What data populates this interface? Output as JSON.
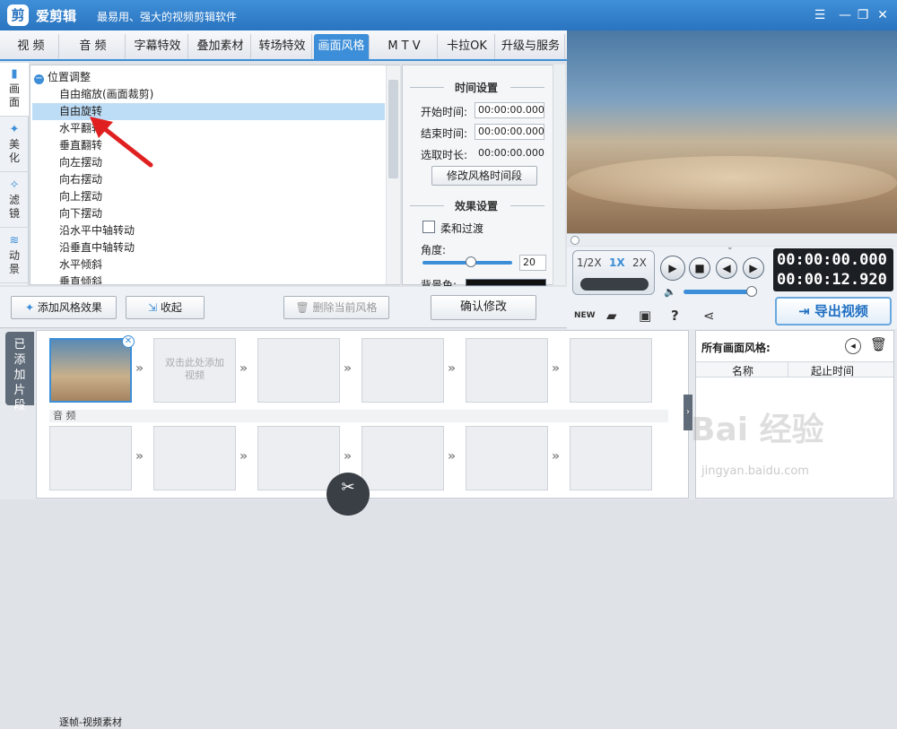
{
  "app": {
    "name": "爱剪辑",
    "logo": "剪",
    "slogan": "最易用、强大的视频剪辑软件"
  },
  "window": {
    "menu": "☰",
    "minimize": "—",
    "maximize": "❐",
    "close": "✕"
  },
  "tabs": [
    "视 频",
    "音 频",
    "字幕特效",
    "叠加素材",
    "转场特效",
    "画面风格",
    "M T V",
    "卡拉OK",
    "升级与服务"
  ],
  "active_tab": "画面风格",
  "side_tabs": [
    "画面",
    "美化",
    "滤镜",
    "动景"
  ],
  "tree": {
    "root": "位置调整",
    "items": [
      "自由缩放(画面裁剪)",
      "自由旋转",
      "水平翻转",
      "垂直翻转",
      "向左摆动",
      "向右摆动",
      "向上摆动",
      "向下摆动",
      "沿水平中轴转动",
      "沿垂直中轴转动",
      "水平倾斜",
      "垂直倾斜"
    ],
    "selected": "自由旋转"
  },
  "settings": {
    "time_title": "时间设置",
    "start_label": "开始时间:",
    "start_value": "00:00:00.000",
    "end_label": "结束时间:",
    "end_value": "00:00:00.000",
    "dur_label": "选取时长:",
    "dur_value": "00:00:00.000",
    "modify_btn": "修改风格时间段",
    "effect_title": "效果设置",
    "soft_label": "柔和过渡",
    "angle_label": "角度:",
    "angle_value": "20",
    "bg_label": "背景色:",
    "confirm_btn": "确认修改"
  },
  "actions": {
    "add": "添加风格效果",
    "collapse": "收起",
    "delete": "删除当前风格"
  },
  "player": {
    "speeds": [
      "1/2X",
      "1X",
      "2X"
    ],
    "current_time": "00:00:00.000",
    "total_time": "00:00:12.920",
    "export": "导出视频",
    "new_label": "NEW"
  },
  "timeline": {
    "added_tab": "已添加片段",
    "first_clip": "逐帧-视频素材",
    "placeholder": "双击此处添加视频",
    "audio_label": "音 频"
  },
  "right_panel": {
    "title": "所有画面风格:",
    "col_name": "名称",
    "col_time": "起止时间"
  },
  "watermark": {
    "logo": "Bai 经验",
    "url": "jingyan.baidu.com"
  },
  "colors": {
    "accent": "#3c8ed8",
    "arrow": "#e02020"
  }
}
